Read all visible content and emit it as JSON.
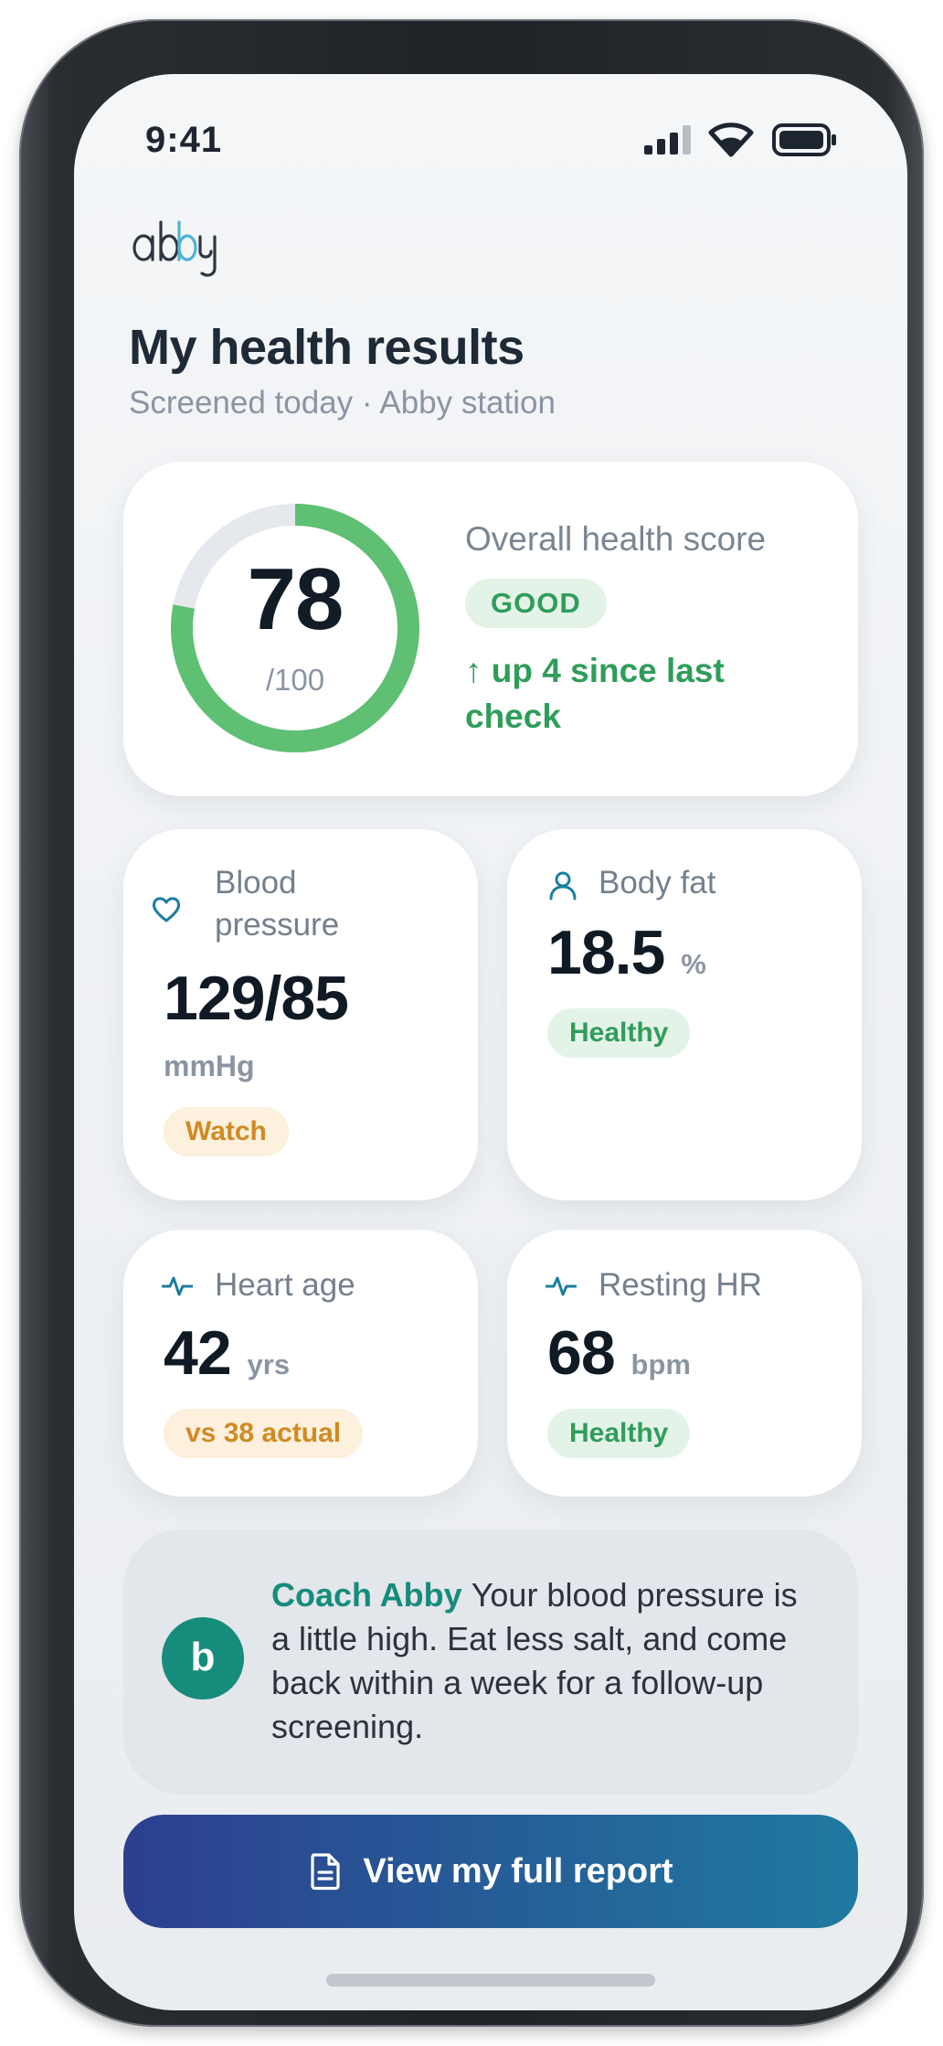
{
  "status_bar": {
    "time": "9:41"
  },
  "brand": {
    "logo_text": "abby"
  },
  "header": {
    "title": "My health results",
    "subtitle": "Screened today · Abby station"
  },
  "score": {
    "value": "78",
    "max": "/100",
    "fraction": 0.78,
    "label": "Overall health score",
    "rating": "GOOD",
    "trend": "↑ up 4 since last check",
    "color": "#5fbf73"
  },
  "metrics": {
    "blood_pressure": {
      "label": "Blood pressure",
      "value": "129/85",
      "unit": "mmHg",
      "status": "Watch",
      "icon": "heart-icon"
    },
    "body_fat": {
      "label": "Body fat",
      "value": "18.5",
      "unit": "%",
      "status": "Healthy",
      "icon": "person-icon"
    },
    "heart_age": {
      "label": "Heart age",
      "value": "42",
      "unit": "yrs",
      "status": "vs 38 actual",
      "icon": "pulse-icon"
    },
    "resting_hr": {
      "label": "Resting HR",
      "value": "68",
      "unit": "bpm",
      "status": "Healthy",
      "icon": "pulse-icon"
    }
  },
  "coach": {
    "avatar_letter": "b",
    "name": "Coach Abby",
    "message": "Your blood pressure is a little high. Eat less salt, and come back within a week for a follow-up screening."
  },
  "cta": {
    "label": "View my full report",
    "icon": "document-icon"
  },
  "colors": {
    "accent_teal": "#168c7c",
    "healthy_green": "#2f9d5a",
    "watch_amber": "#d08a25"
  }
}
